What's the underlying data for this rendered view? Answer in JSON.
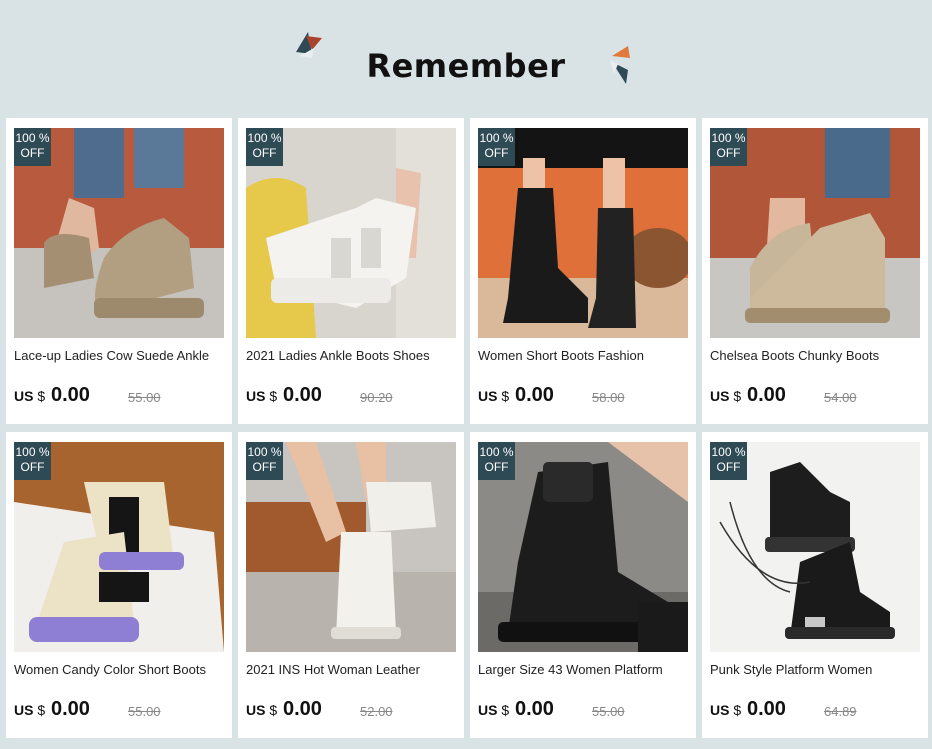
{
  "section": {
    "title": "Remember"
  },
  "colors": {
    "background": "#d9e3e6",
    "badge": "#2e4a55",
    "accent_red": "#a8442e",
    "accent_orange": "#e07a3c"
  },
  "products": [
    {
      "discount_pct": "100 %",
      "discount_off": "OFF",
      "name": "Lace-up Ladies Cow Suede Ankle",
      "currency_prefix": "US",
      "currency_symbol": "$",
      "price": "0.00",
      "old_price": "55.00",
      "image": "beige-suede-lace-up-boots"
    },
    {
      "discount_pct": "100 %",
      "discount_off": "OFF",
      "name": "2021 Ladies Ankle Boots  Shoes",
      "currency_prefix": "US",
      "currency_symbol": "$",
      "price": "0.00",
      "old_price": "90.20",
      "image": "white-buckle-ankle-boots"
    },
    {
      "discount_pct": "100 %",
      "discount_off": "OFF",
      "name": "Women Short Boots Fashion",
      "currency_prefix": "US",
      "currency_symbol": "$",
      "price": "0.00",
      "old_price": "58.00",
      "image": "black-short-boots"
    },
    {
      "discount_pct": "100 %",
      "discount_off": "OFF",
      "name": "Chelsea Boots Chunky Boots",
      "currency_prefix": "US",
      "currency_symbol": "$",
      "price": "0.00",
      "old_price": "54.00",
      "image": "beige-chelsea-boots"
    },
    {
      "discount_pct": "100 %",
      "discount_off": "OFF",
      "name": "Women Candy Color Short Boots",
      "currency_prefix": "US",
      "currency_symbol": "$",
      "price": "0.00",
      "old_price": "55.00",
      "image": "candy-color-chelsea-boots"
    },
    {
      "discount_pct": "100 %",
      "discount_off": "OFF",
      "name": "2021 INS Hot Woman Leather",
      "currency_prefix": "US",
      "currency_symbol": "$",
      "price": "0.00",
      "old_price": "52.00",
      "image": "white-leather-boots"
    },
    {
      "discount_pct": "100 %",
      "discount_off": "OFF",
      "name": "Larger Size 43 Women Platform",
      "currency_prefix": "US",
      "currency_symbol": "$",
      "price": "0.00",
      "old_price": "55.00",
      "image": "black-platform-pocket-boots"
    },
    {
      "discount_pct": "100 %",
      "discount_off": "OFF",
      "name": "Punk Style Platform Women",
      "currency_prefix": "US",
      "currency_symbol": "$",
      "price": "0.00",
      "old_price": "64.89",
      "image": "punk-platform-boots"
    }
  ]
}
